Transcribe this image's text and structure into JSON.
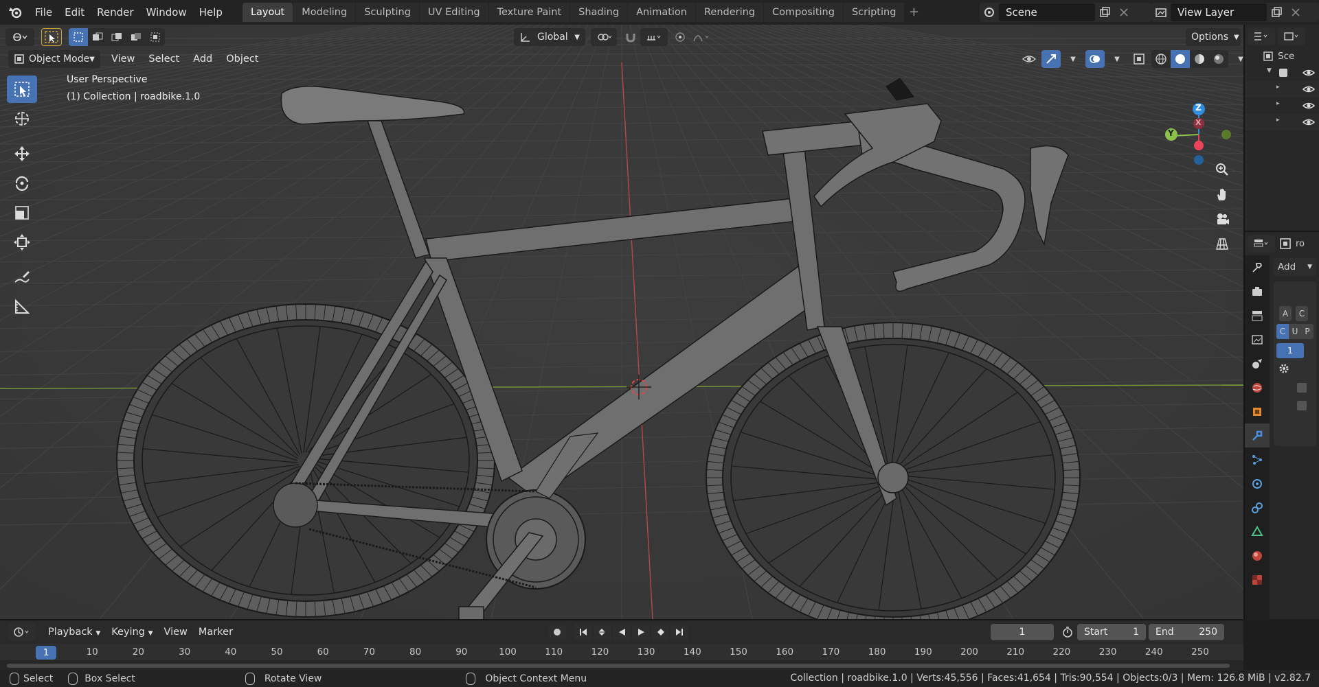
{
  "topbar": {
    "menus": [
      "File",
      "Edit",
      "Render",
      "Window",
      "Help"
    ],
    "workspaces": [
      "Layout",
      "Modeling",
      "Sculpting",
      "UV Editing",
      "Texture Paint",
      "Shading",
      "Animation",
      "Rendering",
      "Compositing",
      "Scripting"
    ],
    "active_workspace": "Layout",
    "add_label": "+",
    "scene": "Scene",
    "view_layer": "View Layer"
  },
  "viewport_header": {
    "transform_orientation": "Global",
    "options_label": "Options",
    "mode": "Object Mode",
    "menus": [
      "View",
      "Select",
      "Add",
      "Object"
    ]
  },
  "viewport": {
    "perspective_label": "User Perspective",
    "collection_label": "(1) Collection | roadbike.1.0",
    "gizmo": {
      "z": "Z",
      "y": "Y",
      "x": "X"
    }
  },
  "properties": {
    "add_label": "Add",
    "btn_a": "A",
    "btn_c": "C",
    "seg": [
      "C",
      "U",
      "P"
    ],
    "value": "1"
  },
  "outliner": {
    "title": "Sce"
  },
  "timeline": {
    "menus": [
      "Playback",
      "Keying",
      "View",
      "Marker"
    ],
    "current_frame": "1",
    "start_label": "Start",
    "start_value": "1",
    "end_label": "End",
    "end_value": "250",
    "ruler_ticks": [
      "10",
      "20",
      "30",
      "40",
      "50",
      "60",
      "70",
      "80",
      "90",
      "100",
      "110",
      "120",
      "130",
      "140",
      "150",
      "160",
      "170",
      "180",
      "190",
      "200",
      "210",
      "220",
      "230",
      "240",
      "250"
    ],
    "ruler_current": "1"
  },
  "statusbar": {
    "select": "Select",
    "box_select": "Box Select",
    "rotate_view": "Rotate View",
    "context_menu": "Object Context Menu",
    "stats": "Collection | roadbike.1.0 | Verts:45,556 | Faces:41,654 | Tris:90,554 | Objects:0/3 | Mem: 126.8 MiB | v2.82.7"
  },
  "colors": {
    "accent": "#4772b3",
    "viewport_bg": "#393939",
    "x_axis": "#e8445a",
    "y_axis": "#8bc34a",
    "z_axis": "#2f8ee0"
  }
}
